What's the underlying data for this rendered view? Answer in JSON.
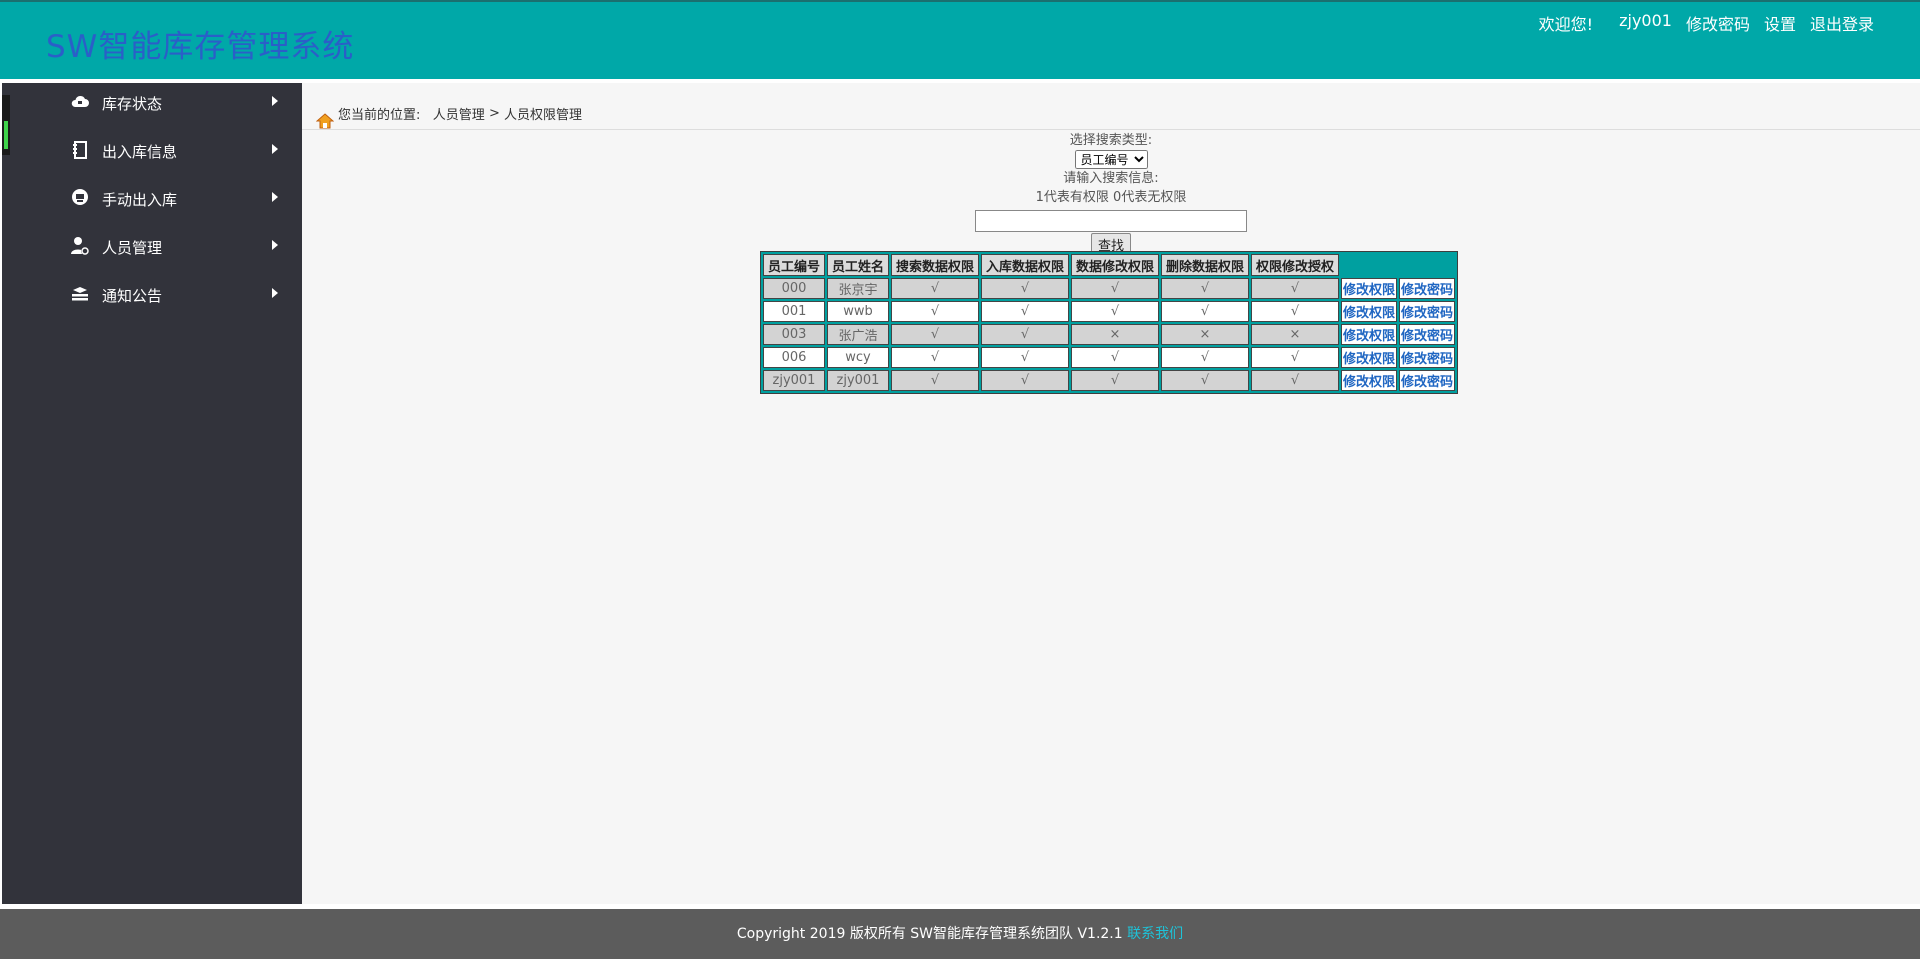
{
  "header": {
    "title": "SW智能库存管理系统",
    "welcome": "欢迎您!",
    "username": "zjy001",
    "change_password": "修改密码",
    "settings": "设置",
    "logout": "退出登录"
  },
  "sidebar": {
    "items": [
      {
        "label": "库存状态",
        "icon": "cloud-icon"
      },
      {
        "label": "出入库信息",
        "icon": "notebook-icon"
      },
      {
        "label": "手动出入库",
        "icon": "inbox-icon"
      },
      {
        "label": "人员管理",
        "icon": "user-gear-icon"
      },
      {
        "label": "通知公告",
        "icon": "stack-icon"
      }
    ]
  },
  "breadcrumb": {
    "prefix": "您当前的位置:",
    "level1": "人员管理",
    "separator": ">",
    "level2": "人员权限管理"
  },
  "search": {
    "type_label": "选择搜索类型:",
    "selected_type": "员工编号",
    "input_label": "请输入搜索信息:",
    "hint": "1代表有权限 0代表无权限",
    "input_value": "",
    "button": "查找"
  },
  "table": {
    "headers": [
      "员工编号",
      "员工姓名",
      "搜索数据权限",
      "入库数据权限",
      "数据修改权限",
      "删除数据权限",
      "权限修改授权"
    ],
    "action_labels": {
      "edit_permission": "修改权限",
      "edit_password": "修改密码"
    },
    "rows": [
      {
        "id": "000",
        "name": "张京宇",
        "perms": [
          "√",
          "√",
          "√",
          "√",
          "√"
        ]
      },
      {
        "id": "001",
        "name": "wwb",
        "perms": [
          "√",
          "√",
          "√",
          "√",
          "√"
        ]
      },
      {
        "id": "003",
        "name": "张广浩",
        "perms": [
          "√",
          "√",
          "×",
          "×",
          "×"
        ]
      },
      {
        "id": "006",
        "name": "wcy",
        "perms": [
          "√",
          "√",
          "√",
          "√",
          "√"
        ]
      },
      {
        "id": "zjy001",
        "name": "zjy001",
        "perms": [
          "√",
          "√",
          "√",
          "√",
          "√"
        ]
      }
    ]
  },
  "footer": {
    "copyright": "Copyright 2019 版权所有 SW智能库存管理系统团队 V1.2.1",
    "contact": "联系我们"
  },
  "colors": {
    "header_bg": "#00a8a8",
    "title": "#2a5fc8",
    "sidebar_bg": "#32333b",
    "footer_bg": "#5c5c5c",
    "link": "#1f66c2",
    "contact": "#1ec3d8"
  }
}
